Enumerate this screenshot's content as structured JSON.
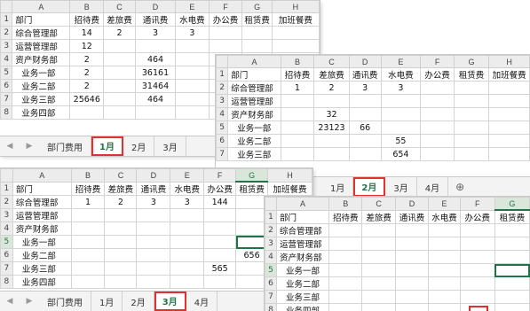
{
  "columns": [
    "A",
    "B",
    "C",
    "D",
    "E",
    "F",
    "G",
    "H"
  ],
  "headers": [
    "部门",
    "招待费",
    "差旅费",
    "通讯费",
    "水电费",
    "办公费",
    "租赁费",
    "加班餐费"
  ],
  "sheet_tabs": [
    "部门费用",
    "1月",
    "2月",
    "3月",
    "4月"
  ],
  "add_sheet_icon": "plus-circle-icon",
  "sheet_jan": {
    "active_tab": "1月",
    "rows": [
      [
        "综合管理部",
        "14",
        "2",
        "3",
        "3",
        "",
        "",
        ""
      ],
      [
        "运营管理部",
        "12",
        "",
        "",
        "",
        "",
        "",
        ""
      ],
      [
        "资产财务部",
        "2",
        "",
        "464",
        "",
        "",
        "",
        ""
      ],
      [
        "业务一部",
        "2",
        "",
        "36161",
        "",
        "",
        "",
        ""
      ],
      [
        "业务二部",
        "2",
        "",
        "31464",
        "",
        "",
        "",
        ""
      ],
      [
        "业务三部",
        "25646",
        "",
        "464",
        "",
        "",
        "",
        ""
      ],
      [
        "业务四部",
        "",
        "",
        "",
        "",
        "",
        "",
        ""
      ]
    ]
  },
  "sheet_feb": {
    "active_tab": "2月",
    "rows": [
      [
        "综合管理部",
        "1",
        "2",
        "3",
        "3",
        "",
        "",
        ""
      ],
      [
        "运营管理部",
        "",
        "",
        "",
        "",
        "",
        "",
        ""
      ],
      [
        "资产财务部",
        "",
        "32",
        "",
        "",
        "",
        "",
        ""
      ],
      [
        "业务一部",
        "",
        "23123",
        "66",
        "",
        "",
        "",
        ""
      ],
      [
        "业务二部",
        "",
        "",
        "",
        "55",
        "",
        "",
        ""
      ],
      [
        "业务三部",
        "",
        "",
        "",
        "654",
        "",
        "",
        ""
      ]
    ]
  },
  "sheet_mar": {
    "active_tab": "3月",
    "rows": [
      [
        "综合管理部",
        "1",
        "2",
        "3",
        "3",
        "144",
        "",
        ""
      ],
      [
        "运营管理部",
        "",
        "",
        "",
        "",
        "",
        "",
        ""
      ],
      [
        "资产财务部",
        "",
        "",
        "",
        "",
        "",
        "",
        ""
      ],
      [
        "业务一部",
        "",
        "",
        "",
        "",
        "",
        "",
        ""
      ],
      [
        "业务二部",
        "",
        "",
        "",
        "",
        "",
        "656",
        ""
      ],
      [
        "业务三部",
        "",
        "",
        "",
        "",
        "565",
        "",
        ""
      ],
      [
        "业务四部",
        "",
        "",
        "",
        "",
        "",
        "",
        ""
      ]
    ]
  },
  "sheet_apr": {
    "rows": [
      [
        "综合管理部",
        "",
        "",
        "",
        "",
        "",
        "",
        ""
      ],
      [
        "运营管理部",
        "",
        "",
        "",
        "",
        "",
        "",
        ""
      ],
      [
        "资产财务部",
        "",
        "",
        "",
        "",
        "",
        "",
        ""
      ],
      [
        "业务一部",
        "",
        "",
        "",
        "",
        "",
        "",
        ""
      ],
      [
        "业务二部",
        "",
        "",
        "",
        "",
        "",
        "",
        ""
      ],
      [
        "业务三部",
        "",
        "",
        "",
        "",
        "",
        "",
        ""
      ],
      [
        "业务四部",
        "",
        "",
        "",
        "",
        "",
        "",
        ""
      ]
    ]
  }
}
